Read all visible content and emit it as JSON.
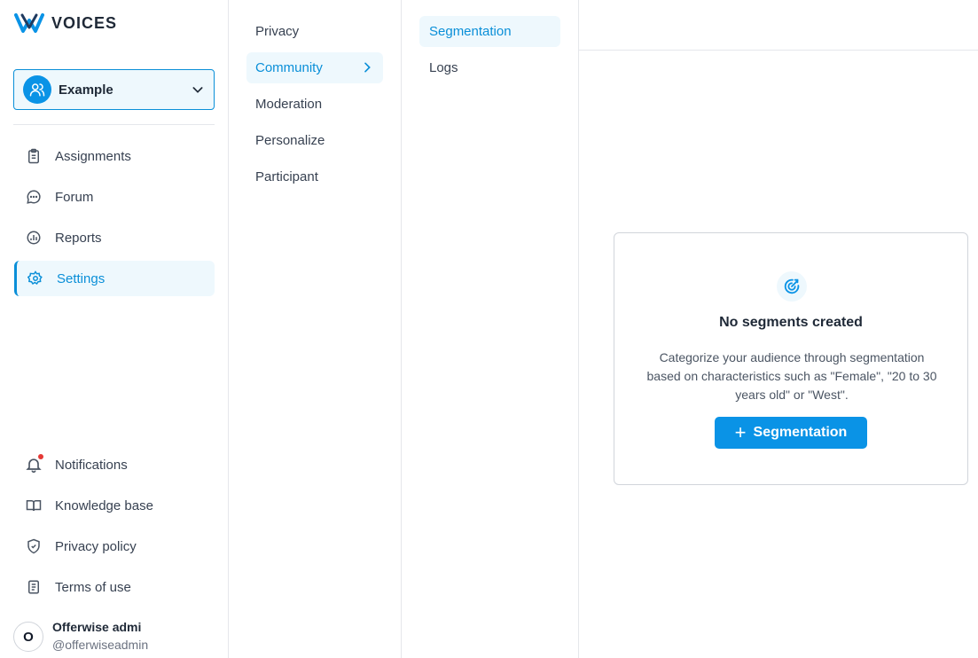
{
  "brand": {
    "name": "VOICES",
    "accent": "#0a93e6"
  },
  "community_selector": {
    "value": "Example"
  },
  "sidebar": {
    "main_items": [
      {
        "label": "Assignments",
        "icon": "clipboard-icon"
      },
      {
        "label": "Forum",
        "icon": "chat-bubble-icon"
      },
      {
        "label": "Reports",
        "icon": "chart-icon"
      },
      {
        "label": "Settings",
        "icon": "gear-icon",
        "active": true
      }
    ],
    "bottom_items": [
      {
        "label": "Notifications",
        "icon": "bell-icon",
        "badge": true
      },
      {
        "label": "Knowledge base",
        "icon": "book-icon"
      },
      {
        "label": "Privacy policy",
        "icon": "shield-icon"
      },
      {
        "label": "Terms of use",
        "icon": "document-icon"
      }
    ],
    "user": {
      "initial": "O",
      "name": "Offerwise admi",
      "handle": "@offerwiseadmin"
    }
  },
  "settings_menu": {
    "items": [
      {
        "label": "Privacy"
      },
      {
        "label": "Community",
        "active": true
      },
      {
        "label": "Moderation"
      },
      {
        "label": "Personalize"
      },
      {
        "label": "Participant"
      }
    ]
  },
  "community_menu": {
    "items": [
      {
        "label": "Segmentation",
        "active": true
      },
      {
        "label": "Logs"
      }
    ]
  },
  "empty_state": {
    "icon": "target-icon",
    "title": "No segments created",
    "description": "Categorize your audience through segmentation based on characteristics such as \"Female\", \"20 to 30 years old\" or \"West\".",
    "button_label": "Segmentation"
  }
}
